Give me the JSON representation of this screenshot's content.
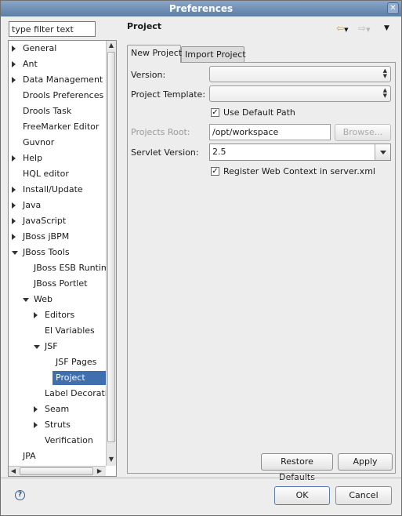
{
  "window": {
    "title": "Preferences",
    "close_symbol": "✕"
  },
  "filter": {
    "placeholder": "type filter text",
    "value": "type filter text"
  },
  "tree": {
    "items": [
      {
        "label": "General",
        "arrow": "right",
        "depth": 0
      },
      {
        "label": "Ant",
        "arrow": "right",
        "depth": 0
      },
      {
        "label": "Data Management",
        "arrow": "right",
        "depth": 0
      },
      {
        "label": "Drools Preferences",
        "arrow": "none",
        "depth": 0
      },
      {
        "label": "Drools Task",
        "arrow": "none",
        "depth": 0
      },
      {
        "label": "FreeMarker Editor",
        "arrow": "none",
        "depth": 0
      },
      {
        "label": "Guvnor",
        "arrow": "none",
        "depth": 0
      },
      {
        "label": "Help",
        "arrow": "right",
        "depth": 0
      },
      {
        "label": "HQL editor",
        "arrow": "none",
        "depth": 0
      },
      {
        "label": "Install/Update",
        "arrow": "right",
        "depth": 0
      },
      {
        "label": "Java",
        "arrow": "right",
        "depth": 0
      },
      {
        "label": "JavaScript",
        "arrow": "right",
        "depth": 0
      },
      {
        "label": "JBoss jBPM",
        "arrow": "right",
        "depth": 0
      },
      {
        "label": "JBoss Tools",
        "arrow": "down",
        "depth": 0
      },
      {
        "label": "JBoss ESB Runtim",
        "arrow": "none",
        "depth": 1
      },
      {
        "label": "JBoss Portlet",
        "arrow": "none",
        "depth": 1
      },
      {
        "label": "Web",
        "arrow": "down",
        "depth": 1
      },
      {
        "label": "Editors",
        "arrow": "right",
        "depth": 2
      },
      {
        "label": "El Variables",
        "arrow": "none",
        "depth": 2
      },
      {
        "label": "JSF",
        "arrow": "down",
        "depth": 2
      },
      {
        "label": "JSF Pages",
        "arrow": "none",
        "depth": 3
      },
      {
        "label": "Project",
        "arrow": "none",
        "depth": 3,
        "selected": true
      },
      {
        "label": "Label Decoratio",
        "arrow": "none",
        "depth": 2
      },
      {
        "label": "Seam",
        "arrow": "right",
        "depth": 2
      },
      {
        "label": "Struts",
        "arrow": "right",
        "depth": 2
      },
      {
        "label": "Verification",
        "arrow": "none",
        "depth": 2
      },
      {
        "label": "JPA",
        "arrow": "none",
        "depth": 0
      }
    ]
  },
  "page": {
    "title": "Project",
    "tabs": [
      {
        "label": "New Project",
        "active": true
      },
      {
        "label": "Import Project",
        "active": false
      }
    ],
    "form": {
      "version_label": "Version:",
      "template_label": "Project Template:",
      "use_default_path_label": "Use Default Path",
      "use_default_path_checked": true,
      "projects_root_label": "Projects Root:",
      "projects_root_value": "/opt/workspace",
      "browse_label": "Browse...",
      "servlet_label": "Servlet Version:",
      "servlet_value": "2.5",
      "register_label": "Register Web Context in server.xml",
      "register_checked": true
    },
    "restore_defaults_label": "Restore Defaults",
    "apply_label": "Apply"
  },
  "footer": {
    "ok_label": "OK",
    "cancel_label": "Cancel",
    "help_symbol": "?"
  },
  "icons": {
    "back": "back-arrow-icon",
    "forward": "forward-arrow-icon",
    "menu": "view-menu-icon",
    "help": "help-icon"
  },
  "colors": {
    "selection": "#3f6fae",
    "titlebar": "#5c7ea6"
  }
}
